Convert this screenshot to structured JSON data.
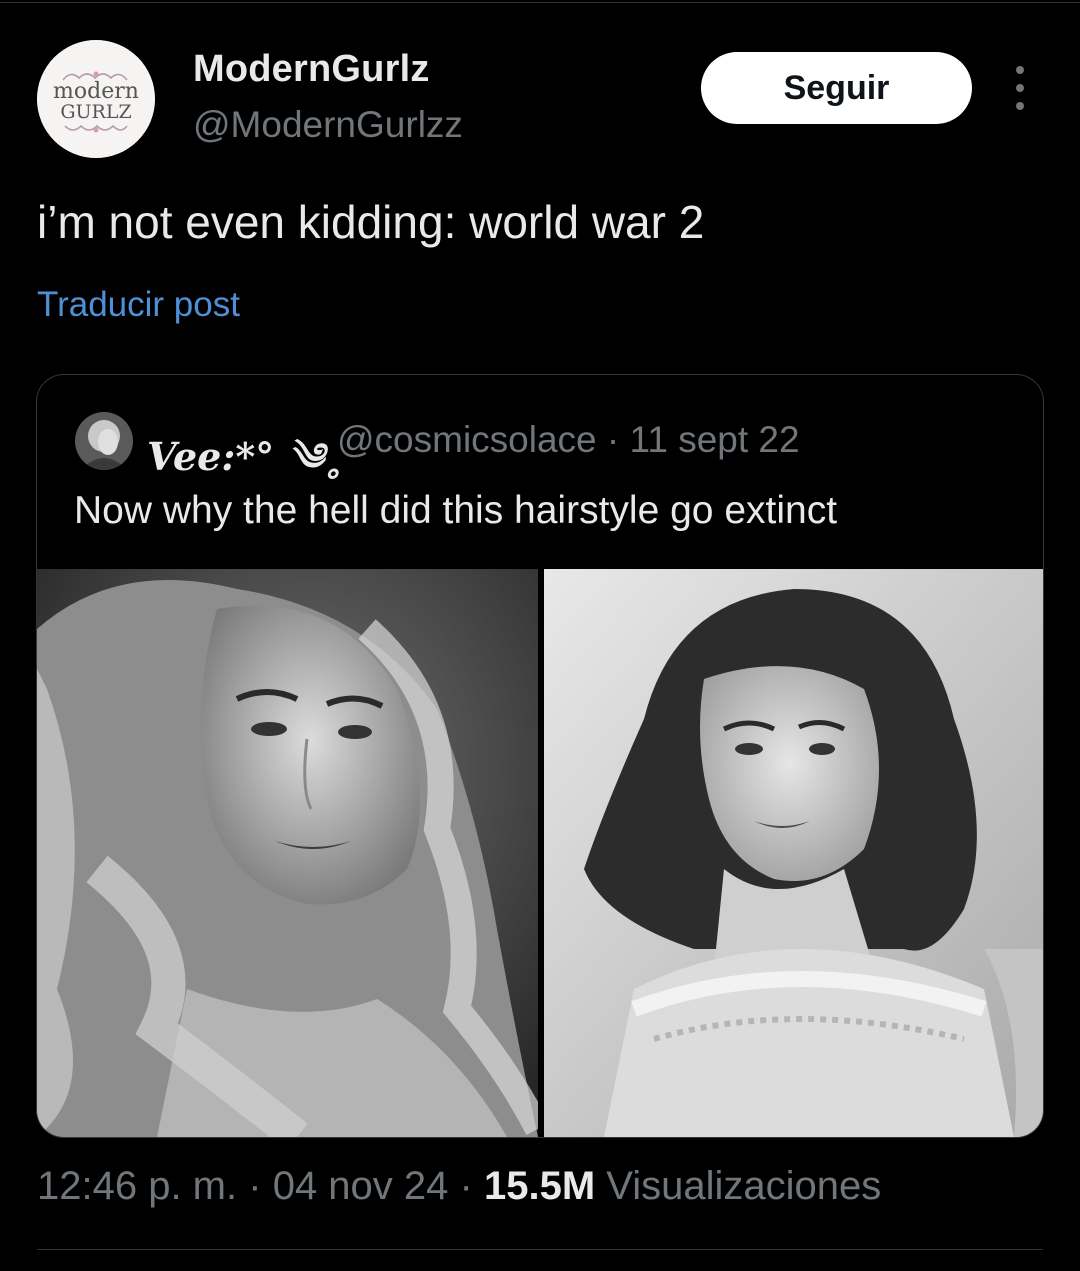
{
  "author": {
    "display_name": "ModernGurlz",
    "handle": "@ModernGurlzz",
    "avatar_logo_line1": "modern",
    "avatar_logo_line2": "GURLZ"
  },
  "actions": {
    "follow_label": "Seguir",
    "more_icon": "more-vertical-icon"
  },
  "post": {
    "text": "i’m not even kidding: world war 2",
    "translate_label": "Traducir post"
  },
  "quoted_post": {
    "display_name": "Vee:*° ༄˳",
    "handle": "@cosmicsolace",
    "separator": "·",
    "date": "11 sept 22",
    "text": "Now why the hell did this hairstyle go extinct",
    "images": [
      "vintage-portrait-blonde-waves",
      "vintage-portrait-brunette-curls"
    ]
  },
  "footer": {
    "time": "12:46 p. m.",
    "separator": "·",
    "date": "04 nov 24",
    "views_count": "15.5M",
    "views_label": "Visualizaciones"
  },
  "colors": {
    "background": "#000000",
    "text_primary": "#e7e9ea",
    "text_secondary": "#71767b",
    "link": "#4f8fd6",
    "border": "#333639",
    "button_bg": "#ffffff"
  }
}
